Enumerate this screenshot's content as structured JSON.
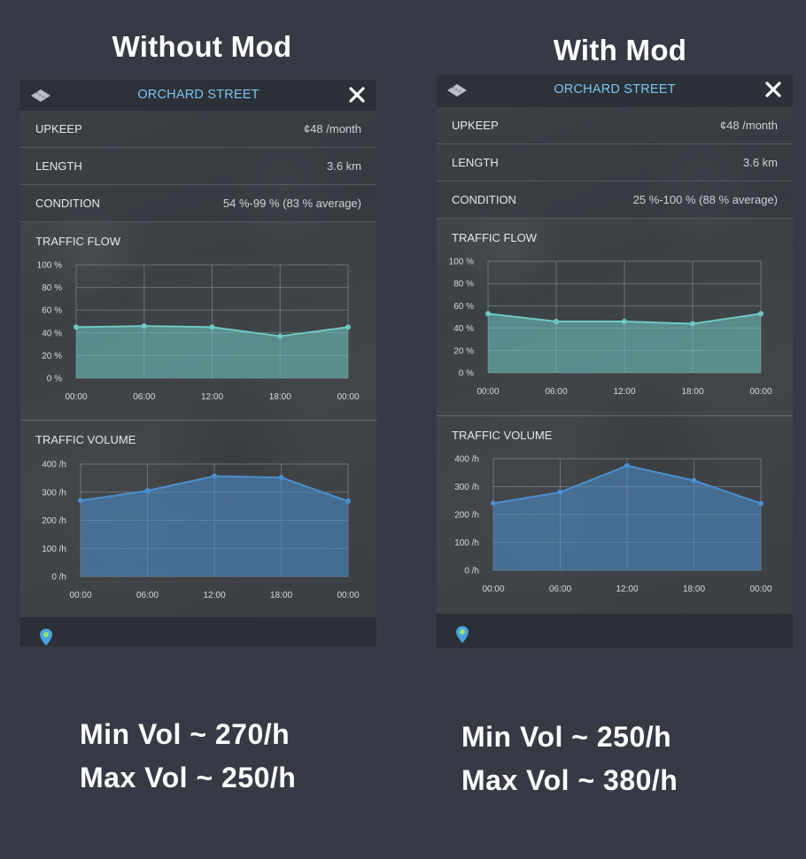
{
  "headings": {
    "left": "Without Mod",
    "right": "With Mod"
  },
  "panels": {
    "left": {
      "title": "ORCHARD STREET",
      "rows": [
        {
          "label": "UPKEEP",
          "value": "¢48 /month"
        },
        {
          "label": "LENGTH",
          "value": "3.6 km"
        },
        {
          "label": "CONDITION",
          "value": "54 %-99 % (83 % average)"
        }
      ],
      "flow_title": "TRAFFIC FLOW",
      "volume_title": "TRAFFIC VOLUME"
    },
    "right": {
      "title": "ORCHARD STREET",
      "rows": [
        {
          "label": "UPKEEP",
          "value": "¢48 /month"
        },
        {
          "label": "LENGTH",
          "value": "3.6 km"
        },
        {
          "label": "CONDITION",
          "value": "25 %-100 % (88 % average)"
        }
      ],
      "flow_title": "TRAFFIC FLOW",
      "volume_title": "TRAFFIC VOLUME"
    }
  },
  "stats": {
    "left": {
      "min": "Min Vol ~ 270/h",
      "max": "Max Vol ~ 250/h"
    },
    "right": {
      "min": "Min Vol ~ 250/h",
      "max": "Max Vol ~ 380/h"
    }
  },
  "colors": {
    "flow": "#6fc9c4",
    "volume": "#4a8fd0",
    "title": "#7ec4ef",
    "background": "#353a44"
  },
  "icons": {
    "header_left": "road-icon",
    "header_right": "close-icon",
    "footer": "map-pin-icon"
  },
  "chart_data": [
    {
      "type": "area",
      "panel": "left",
      "title": "TRAFFIC FLOW",
      "categories": [
        "00:00",
        "06:00",
        "12:00",
        "18:00",
        "00:00"
      ],
      "yticks": [
        "0 %",
        "20 %",
        "40 %",
        "60 %",
        "80 %",
        "100 %"
      ],
      "ylim": [
        0,
        100
      ],
      "values": [
        45,
        46,
        45,
        37,
        45
      ],
      "grid": true
    },
    {
      "type": "area",
      "panel": "left",
      "title": "TRAFFIC VOLUME",
      "categories": [
        "00:00",
        "06:00",
        "12:00",
        "18:00",
        "00:00"
      ],
      "yticks": [
        "0 /h",
        "100 /h",
        "200 /h",
        "300 /h",
        "400 /h"
      ],
      "ylim": [
        0,
        400
      ],
      "values": [
        270,
        305,
        357,
        352,
        268
      ],
      "grid": true
    },
    {
      "type": "area",
      "panel": "right",
      "title": "TRAFFIC FLOW",
      "categories": [
        "00:00",
        "06:00",
        "12:00",
        "18:00",
        "00:00"
      ],
      "yticks": [
        "0 %",
        "20 %",
        "40 %",
        "60 %",
        "80 %",
        "100 %"
      ],
      "ylim": [
        0,
        100
      ],
      "values": [
        53,
        46,
        46,
        44,
        53
      ],
      "grid": true
    },
    {
      "type": "area",
      "panel": "right",
      "title": "TRAFFIC VOLUME",
      "categories": [
        "00:00",
        "06:00",
        "12:00",
        "18:00",
        "00:00"
      ],
      "yticks": [
        "0 /h",
        "100 /h",
        "200 /h",
        "300 /h",
        "400 /h"
      ],
      "ylim": [
        0,
        400
      ],
      "values": [
        240,
        280,
        375,
        322,
        240
      ],
      "grid": true
    }
  ]
}
